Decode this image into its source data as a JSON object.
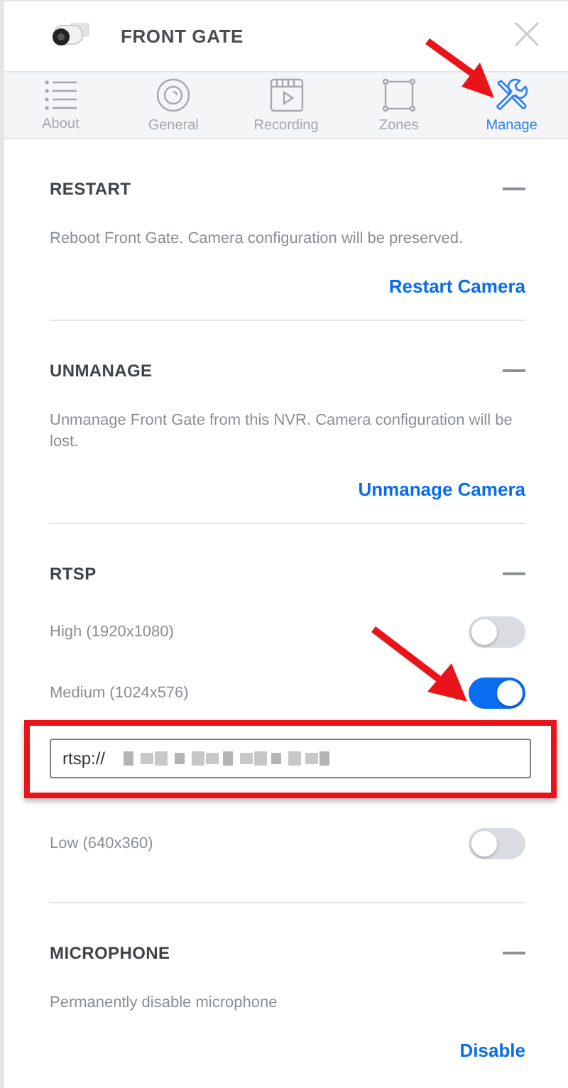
{
  "header": {
    "title": "FRONT GATE"
  },
  "tabs": [
    {
      "label": "About",
      "selected": false
    },
    {
      "label": "General",
      "selected": false
    },
    {
      "label": "Recording",
      "selected": false
    },
    {
      "label": "Zones",
      "selected": false
    },
    {
      "label": "Manage",
      "selected": true
    }
  ],
  "sections": [
    {
      "kind": "action",
      "title": "RESTART",
      "description": "Reboot Front Gate. Camera configuration will be preserved.",
      "action": "Restart Camera"
    },
    {
      "kind": "action",
      "title": "UNMANAGE",
      "description": "Unmanage Front Gate from this NVR. Camera configuration will be lost.",
      "action": "Unmanage Camera"
    },
    {
      "kind": "streams",
      "title": "RTSP",
      "streams": [
        {
          "label": "High (1920x1080)",
          "on": false
        },
        {
          "label": "Medium (1024x576)",
          "on": true,
          "url": {
            "value": "rtsp://",
            "highlighted": true
          }
        },
        {
          "label": "Low (640x360)",
          "on": false
        }
      ]
    },
    {
      "kind": "action",
      "title": "MICROPHONE",
      "description": "Permanently disable microphone",
      "action": "Disable"
    }
  ]
}
